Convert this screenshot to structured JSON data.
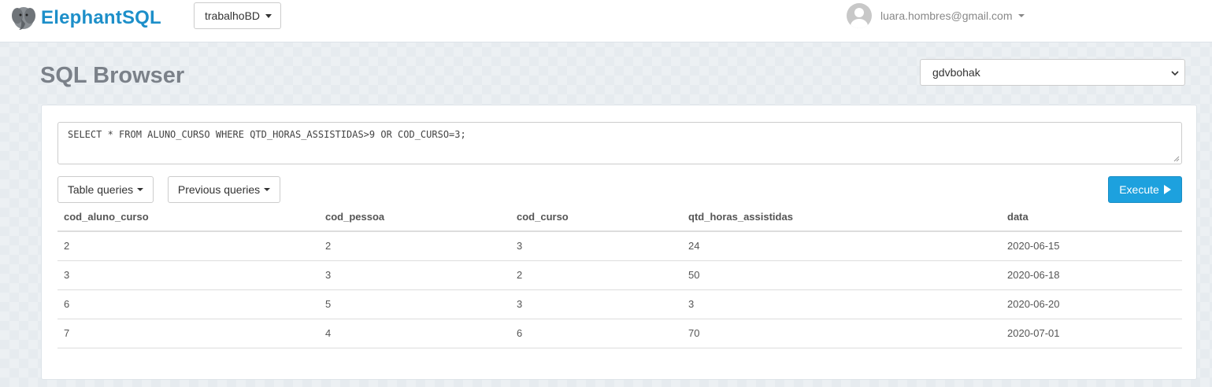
{
  "navbar": {
    "brand_name": "ElephantSQL",
    "instance_name": "trabalhoBD",
    "user_email": "luara.hombres@gmail.com"
  },
  "page": {
    "title": "SQL Browser",
    "database_selected": "gdvbohak"
  },
  "query": {
    "text": "SELECT * FROM ALUNO_CURSO WHERE QTD_HORAS_ASSISTIDAS>9 OR COD_CURSO=3;"
  },
  "buttons": {
    "table_queries": "Table queries",
    "previous_queries": "Previous queries",
    "execute": "Execute"
  },
  "results": {
    "columns": [
      "cod_aluno_curso",
      "cod_pessoa",
      "cod_curso",
      "qtd_horas_assistidas",
      "data"
    ],
    "rows": [
      [
        "2",
        "2",
        "3",
        "24",
        "2020-06-15"
      ],
      [
        "3",
        "3",
        "2",
        "50",
        "2020-06-18"
      ],
      [
        "6",
        "5",
        "3",
        "3",
        "2020-06-20"
      ],
      [
        "7",
        "4",
        "6",
        "70",
        "2020-07-01"
      ]
    ]
  },
  "colors": {
    "brand": "#1d8fc9",
    "execute_button": "#1da1de"
  },
  "icons": {
    "logo": "elephant-logo-icon",
    "avatar": "user-avatar-icon",
    "execute": "play-icon"
  }
}
